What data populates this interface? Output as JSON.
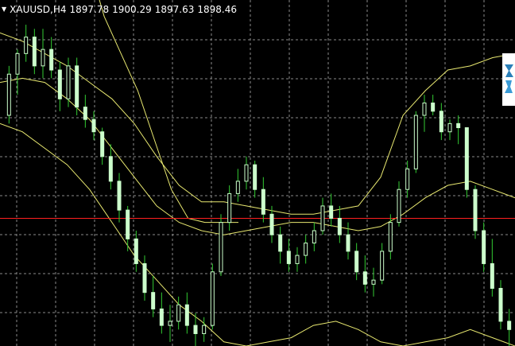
{
  "header": {
    "caret": "▼",
    "symbol": "XAUUSD,H4",
    "open": "1897.78",
    "high": "1900.29",
    "low": "1897.63",
    "close": "1898.46"
  },
  "colors": {
    "background": "#000000",
    "grid": "#8a8a8a",
    "candle": "#ccffcc",
    "wick": "#33cc33",
    "band": "#e8e870",
    "price_line": "#ff2020",
    "header_text": "#ffffff"
  },
  "icons": {
    "side_badge": "metatrader-logo-icon"
  },
  "chart_data": {
    "type": "candlestick",
    "price_range": [
      1878,
      1920
    ],
    "price_line": 1893.5,
    "candles": [
      [
        1906.0,
        1912.0,
        1905.0,
        1911.0
      ],
      [
        1911.0,
        1914.0,
        1908.5,
        1913.5
      ],
      [
        1913.5,
        1917.0,
        1912.5,
        1915.5
      ],
      [
        1915.5,
        1916.5,
        1911.0,
        1912.0
      ],
      [
        1912.0,
        1916.5,
        1910.5,
        1914.0
      ],
      [
        1914.0,
        1915.5,
        1910.5,
        1911.5
      ],
      [
        1911.5,
        1912.5,
        1906.5,
        1908.0
      ],
      [
        1908.0,
        1913.0,
        1907.0,
        1912.0
      ],
      [
        1912.0,
        1913.0,
        1906.0,
        1907.0
      ],
      [
        1907.0,
        1908.5,
        1904.5,
        1905.5
      ],
      [
        1905.5,
        1906.5,
        1903.0,
        1904.0
      ],
      [
        1904.0,
        1904.5,
        1900.0,
        1901.0
      ],
      [
        1901.0,
        1902.5,
        1897.0,
        1898.0
      ],
      [
        1898.0,
        1899.0,
        1893.0,
        1894.5
      ],
      [
        1894.5,
        1895.0,
        1889.5,
        1891.0
      ],
      [
        1891.0,
        1892.0,
        1887.0,
        1888.0
      ],
      [
        1888.0,
        1889.0,
        1883.5,
        1884.5
      ],
      [
        1884.5,
        1886.5,
        1881.5,
        1882.5
      ],
      [
        1882.5,
        1884.5,
        1879.5,
        1880.5
      ],
      [
        1880.5,
        1883.0,
        1878.5,
        1881.0
      ],
      [
        1881.0,
        1884.0,
        1880.0,
        1883.0
      ],
      [
        1883.0,
        1884.5,
        1879.5,
        1880.5
      ],
      [
        1880.5,
        1882.0,
        1878.0,
        1879.5
      ],
      [
        1879.5,
        1881.5,
        1878.5,
        1880.5
      ],
      [
        1880.5,
        1888.0,
        1880.0,
        1887.0
      ],
      [
        1887.0,
        1894.0,
        1886.5,
        1893.0
      ],
      [
        1893.0,
        1897.5,
        1892.0,
        1896.5
      ],
      [
        1896.5,
        1899.5,
        1895.5,
        1898.0
      ],
      [
        1898.0,
        1901.0,
        1897.0,
        1900.0
      ],
      [
        1900.0,
        1900.5,
        1896.0,
        1897.0
      ],
      [
        1897.0,
        1898.5,
        1893.0,
        1894.0
      ],
      [
        1894.0,
        1895.0,
        1890.5,
        1891.5
      ],
      [
        1891.5,
        1892.5,
        1888.0,
        1889.5
      ],
      [
        1889.5,
        1891.0,
        1887.0,
        1888.0
      ],
      [
        1888.0,
        1890.0,
        1887.0,
        1889.0
      ],
      [
        1889.0,
        1891.5,
        1888.0,
        1890.5
      ],
      [
        1890.5,
        1893.0,
        1889.5,
        1892.0
      ],
      [
        1892.0,
        1896.0,
        1891.5,
        1895.0
      ],
      [
        1895.0,
        1896.5,
        1892.5,
        1893.5
      ],
      [
        1893.5,
        1895.0,
        1890.5,
        1891.5
      ],
      [
        1891.5,
        1893.0,
        1888.5,
        1889.5
      ],
      [
        1889.5,
        1890.5,
        1886.0,
        1887.0
      ],
      [
        1887.0,
        1889.0,
        1884.5,
        1885.5
      ],
      [
        1885.5,
        1887.5,
        1884.0,
        1886.0
      ],
      [
        1886.0,
        1890.5,
        1885.5,
        1889.5
      ],
      [
        1889.5,
        1894.0,
        1888.5,
        1893.0
      ],
      [
        1893.0,
        1898.0,
        1892.5,
        1897.0
      ],
      [
        1897.0,
        1900.5,
        1896.0,
        1899.5
      ],
      [
        1899.5,
        1906.5,
        1899.0,
        1906.0
      ],
      [
        1906.0,
        1908.5,
        1904.0,
        1907.5
      ],
      [
        1907.5,
        1908.5,
        1906.0,
        1906.5
      ],
      [
        1906.5,
        1907.5,
        1903.0,
        1904.0
      ],
      [
        1904.0,
        1905.5,
        1903.0,
        1905.0
      ],
      [
        1905.0,
        1906.0,
        1902.5,
        1904.5
      ],
      [
        1904.5,
        1902.5,
        1896.0,
        1897.0
      ],
      [
        1897.0,
        1897.5,
        1891.0,
        1892.0
      ],
      [
        1892.0,
        1893.0,
        1887.0,
        1888.0
      ],
      [
        1888.0,
        1891.0,
        1884.0,
        1885.0
      ],
      [
        1885.0,
        1886.0,
        1880.0,
        1881.0
      ],
      [
        1881.0,
        1882.5,
        1878.0,
        1880.0
      ]
    ],
    "bands": {
      "upper": [
        1916.0,
        1915.0,
        1913.5,
        1912.0,
        1910.0,
        1908.0,
        1905.0,
        1901.0,
        1897.5,
        1895.5,
        1895.5,
        1895.0,
        1894.5,
        1894.0,
        1894.0,
        1894.5,
        1895.0,
        1898.5,
        1906.0,
        1909.0,
        1911.5,
        1912.0,
        1913.0,
        1913.5
      ],
      "middle": [
        1910.0,
        1910.5,
        1910.0,
        1908.0,
        1905.5,
        1902.0,
        1898.5,
        1895.0,
        1893.0,
        1892.0,
        1891.5,
        1892.0,
        1892.5,
        1893.0,
        1893.0,
        1892.5,
        1892.0,
        1892.5,
        1894.0,
        1896.0,
        1897.5,
        1898.0,
        1897.0,
        1896.0
      ],
      "lower": [
        1905.0,
        1904.0,
        1902.0,
        1900.0,
        1897.0,
        1893.0,
        1889.0,
        1886.0,
        1883.0,
        1881.0,
        1878.5,
        1878.0,
        1878.5,
        1879.0,
        1880.5,
        1881.0,
        1880.0,
        1878.5,
        1878.0,
        1878.5,
        1879.0,
        1880.0,
        1879.0,
        1878.0
      ],
      "upper_far": [
        1925.0,
        1918.0,
        1913.5,
        1909.0,
        1903.0,
        1897.0,
        1893.5,
        1893.0,
        1893.0,
        1893.0
      ]
    }
  }
}
